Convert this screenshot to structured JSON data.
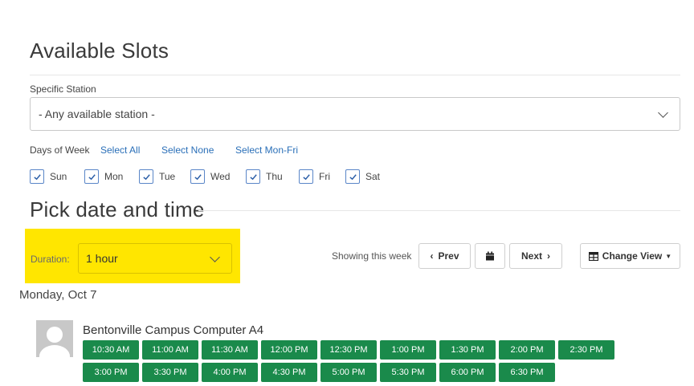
{
  "header": {
    "title": "Available Slots"
  },
  "station": {
    "label": "Specific Station",
    "value": "- Any available station -"
  },
  "days": {
    "label": "Days of Week",
    "links": [
      "Select All",
      "Select None",
      "Select Mon-Fri"
    ],
    "items": [
      {
        "label": "Sun",
        "checked": true
      },
      {
        "label": "Mon",
        "checked": true
      },
      {
        "label": "Tue",
        "checked": true
      },
      {
        "label": "Wed",
        "checked": true
      },
      {
        "label": "Thu",
        "checked": true
      },
      {
        "label": "Fri",
        "checked": true
      },
      {
        "label": "Sat",
        "checked": true
      }
    ]
  },
  "picker": {
    "title": "Pick date and time",
    "duration_label": "Duration:",
    "duration_value": "1 hour",
    "showing_text": "Showing this week",
    "prev_label": "Prev",
    "next_label": "Next",
    "change_view_label": "Change View",
    "highlight_color": "#ffe600"
  },
  "schedule": {
    "date": "Monday, Oct 7",
    "station_name": "Bentonville Campus Computer A4",
    "slot_color": "#1a8a4b",
    "row1": [
      "10:30 AM",
      "11:00 AM",
      "11:30 AM",
      "12:00 PM",
      "12:30 PM",
      "1:00 PM",
      "1:30 PM",
      "2:00 PM",
      "2:30 PM"
    ],
    "row2": [
      "3:00 PM",
      "3:30 PM",
      "4:00 PM",
      "4:30 PM",
      "5:00 PM",
      "5:30 PM",
      "6:00 PM",
      "6:30 PM"
    ]
  }
}
